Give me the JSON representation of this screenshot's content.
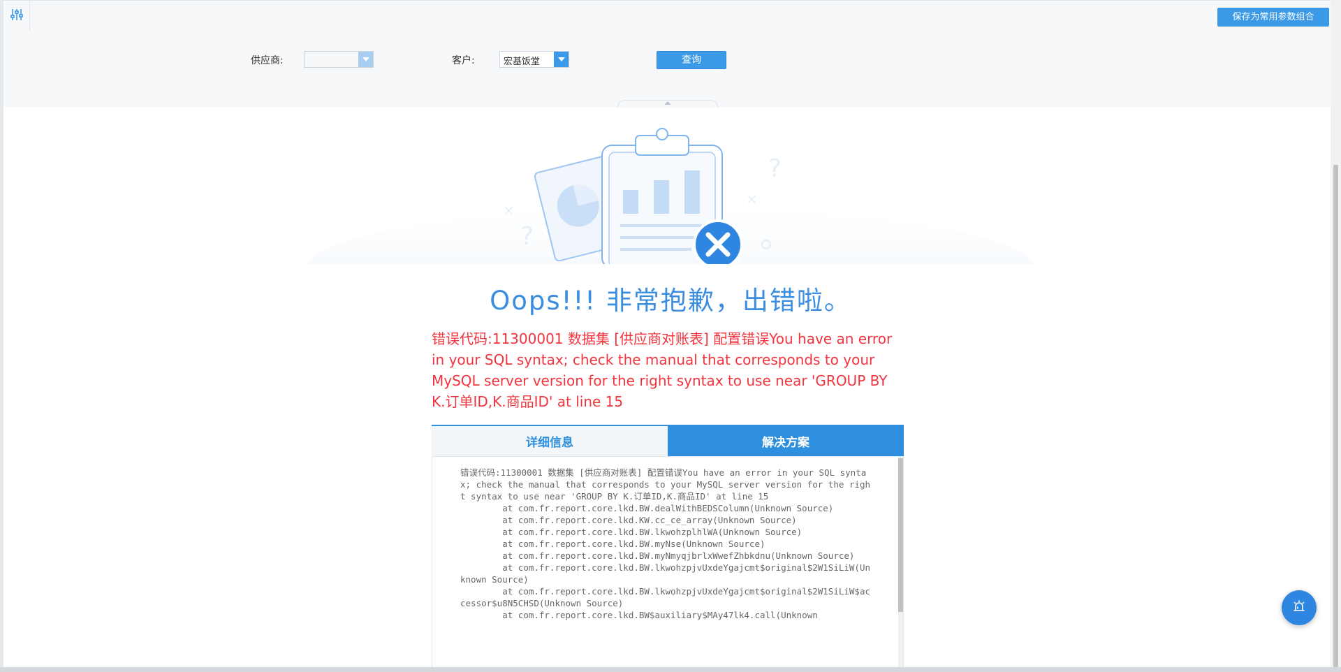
{
  "toolbar": {
    "param_icon": "sliders-icon",
    "save_label": "保存为常用参数组合"
  },
  "params": {
    "supplier_label": "供应商:",
    "supplier_value": "",
    "customer_label": "客户:",
    "customer_value": "宏基饭堂",
    "query_label": "查询"
  },
  "error": {
    "title": "Oops!!! 非常抱歉，出错啦。",
    "message": "错误代码:11300001 数据集 [供应商对账表] 配置错误You have an error in your SQL syntax; check the manual that corresponds to your MySQL server version for the right syntax to use near 'GROUP BY K.订单ID,K.商品ID' at line 15",
    "tabs": [
      "详细信息",
      "解决方案"
    ],
    "detail": "错误代码:11300001 数据集 [供应商对账表] 配置错误You have an error in your SQL syntax; check the manual that corresponds to your MySQL server version for the right syntax to use near 'GROUP BY K.订单ID,K.商品ID' at line 15\n\tat com.fr.report.core.lkd.BW.dealWithBEDSColumn(Unknown Source)\n\tat com.fr.report.core.lkd.KW.cc_ce_array(Unknown Source)\n\tat com.fr.report.core.lkd.BW.lkwohzplhlWA(Unknown Source)\n\tat com.fr.report.core.lkd.BW.myNse(Unknown Source)\n\tat com.fr.report.core.lkd.BW.myNmyqjbrlxWwefZhbkdnu(Unknown Source)\n\tat com.fr.report.core.lkd.BW.lkwohzpjvUxdeYgajcmt$original$2W1SiLiW(Unknown Source)\n\tat com.fr.report.core.lkd.BW.lkwohzpjvUxdeYgajcmt$original$2W1SiLiW$accessor$u8N5CHSD(Unknown Source)\n\tat com.fr.report.core.lkd.BW$auxiliary$MAy47lk4.call(Unknown"
  },
  "float_button_icon": "alarm-icon",
  "colors": {
    "accent": "#3b9ae8",
    "title_blue": "#3b8de0",
    "error_red": "#f2343e"
  }
}
